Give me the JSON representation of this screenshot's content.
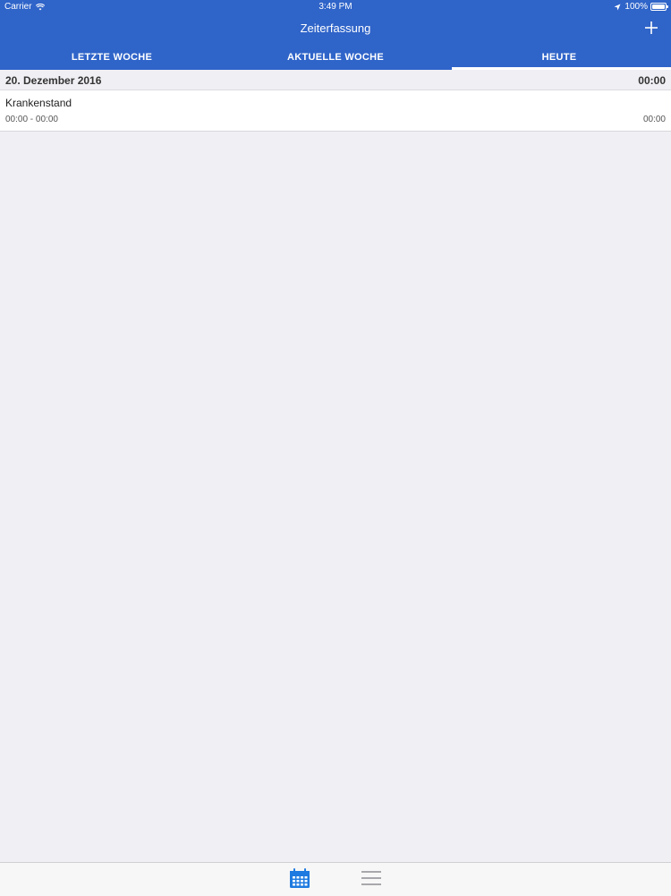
{
  "status_bar": {
    "carrier": "Carrier",
    "time": "3:49 PM",
    "battery": "100%"
  },
  "nav": {
    "title": "Zeiterfassung",
    "add_icon": "plus-icon"
  },
  "tabs": [
    {
      "label": "LETZTE WOCHE"
    },
    {
      "label": "AKTUELLE WOCHE"
    },
    {
      "label": "HEUTE",
      "selected": true
    }
  ],
  "section": {
    "date": "20. Dezember 2016",
    "total": "00:00"
  },
  "entries": [
    {
      "title": "Krankenstand",
      "times": "00:00 - 00:00",
      "duration": "00:00"
    }
  ],
  "bottom_tabs": [
    {
      "icon": "calendar-icon",
      "selected": true
    },
    {
      "icon": "menu-icon",
      "selected": false
    }
  ],
  "colors": {
    "primary": "#2f64c9",
    "background": "#efeff4",
    "active_tab_icon": "#1e7ae0",
    "inactive_tab_icon": "#8e8e93"
  }
}
